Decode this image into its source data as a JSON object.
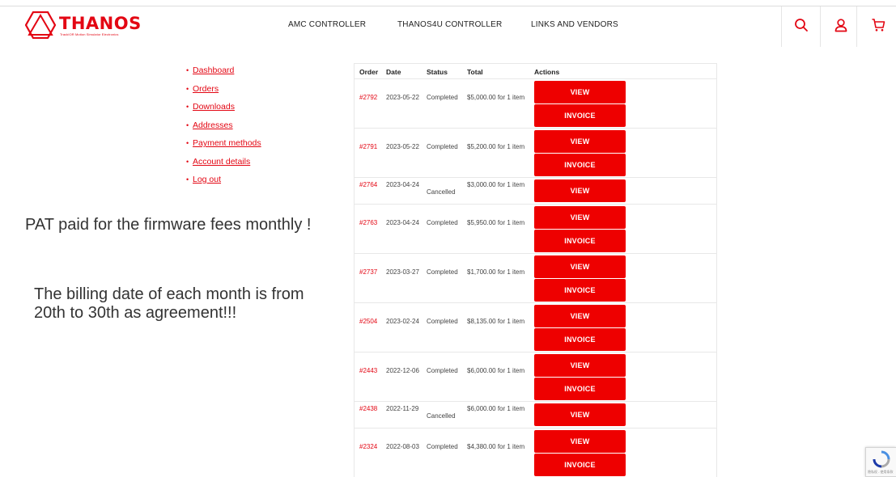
{
  "header": {
    "logo_text": "THANOS",
    "logo_tagline": "TrackIOR Motion Simulator Electronics",
    "nav": [
      "AMC CONTROLLER",
      "THANOS4U CONTROLLER",
      "LINKS AND VENDORS"
    ],
    "icons": [
      "search-icon",
      "user-icon",
      "cart-icon"
    ],
    "accent": "#e30613"
  },
  "sidebar": {
    "items": [
      {
        "label": "Dashboard"
      },
      {
        "label": "Orders"
      },
      {
        "label": "Downloads"
      },
      {
        "label": "Addresses"
      },
      {
        "label": "Payment methods"
      },
      {
        "label": "Account details"
      },
      {
        "label": "Log out"
      }
    ]
  },
  "annotations": {
    "note1": "PAT paid for the firmware fees monthly !",
    "note2": "The billing date of each month is from 20th to 30th as agreement!!!"
  },
  "orders": {
    "columns": [
      "Order",
      "Date",
      "Status",
      "Total",
      "Actions"
    ],
    "view_label": "VIEW",
    "invoice_label": "INVOICE",
    "rows": [
      {
        "order": "#2792",
        "date": "2023-05-22",
        "status": "Completed",
        "total": "$5,000.00 for 1 item",
        "invoice": true
      },
      {
        "order": "#2791",
        "date": "2023-05-22",
        "status": "Completed",
        "total": "$5,200.00 for 1 item",
        "invoice": true
      },
      {
        "order": "#2764",
        "date": "2023-04-24",
        "status": "Cancelled",
        "total": "$3,000.00 for 1 item",
        "invoice": false
      },
      {
        "order": "#2763",
        "date": "2023-04-24",
        "status": "Completed",
        "total": "$5,950.00 for 1 item",
        "invoice": true
      },
      {
        "order": "#2737",
        "date": "2023-03-27",
        "status": "Completed",
        "total": "$1,700.00 for 1 item",
        "invoice": true
      },
      {
        "order": "#2504",
        "date": "2023-02-24",
        "status": "Completed",
        "total": "$8,135.00 for 1 item",
        "invoice": true
      },
      {
        "order": "#2443",
        "date": "2022-12-06",
        "status": "Completed",
        "total": "$6,000.00 for 1 item",
        "invoice": true
      },
      {
        "order": "#2438",
        "date": "2022-11-29",
        "status": "Cancelled",
        "total": "$6,000.00 for 1 item",
        "invoice": false
      },
      {
        "order": "#2324",
        "date": "2022-08-03",
        "status": "Completed",
        "total": "$4,380.00 for 1 item",
        "invoice": true
      }
    ]
  },
  "recaptcha": {
    "text": "隐私权 - 使用条款"
  }
}
